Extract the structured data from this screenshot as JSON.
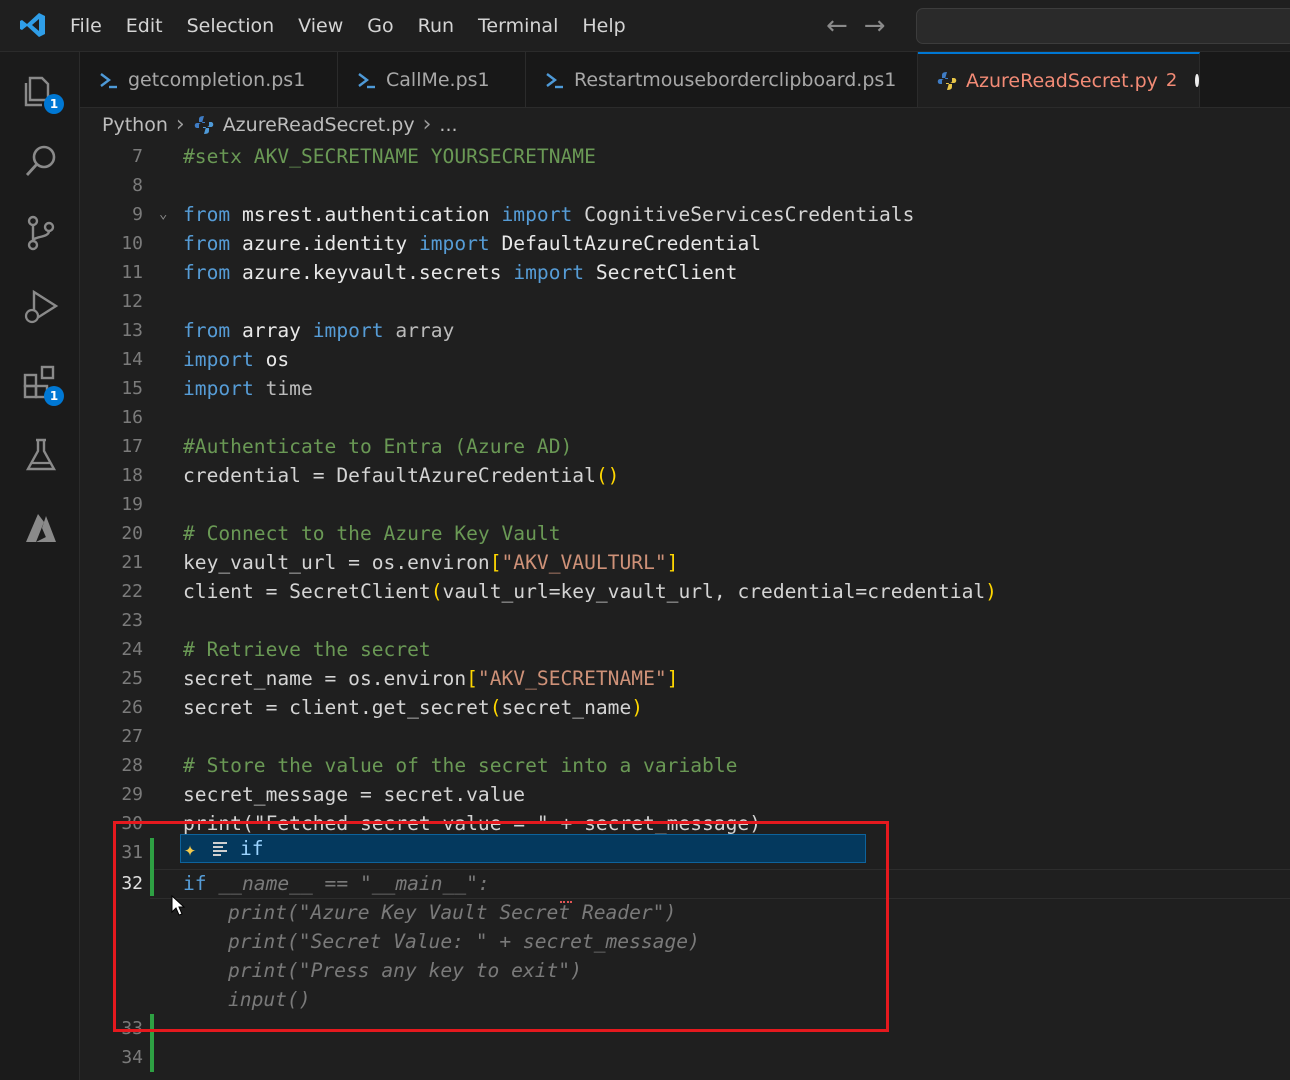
{
  "menu": {
    "items": [
      "File",
      "Edit",
      "Selection",
      "View",
      "Go",
      "Run",
      "Terminal",
      "Help"
    ]
  },
  "activity_bar": {
    "explorer_badge": "1",
    "extensions_badge": "1"
  },
  "tabs": [
    {
      "label": "getcompletion.ps1",
      "icon": "powershell-icon"
    },
    {
      "label": "CallMe.ps1",
      "icon": "powershell-icon"
    },
    {
      "label": "Restartmouseborderclipboard.ps1",
      "icon": "powershell-icon"
    },
    {
      "label": "AzureReadSecret.py",
      "icon": "python-icon",
      "badge": "2",
      "active": true,
      "unsaved": true
    }
  ],
  "breadcrumb": {
    "folder": "Python",
    "file": "AzureReadSecret.py",
    "tail": "..."
  },
  "editor": {
    "line_numbers": [
      "7",
      "8",
      "9",
      "10",
      "11",
      "12",
      "13",
      "14",
      "15",
      "16",
      "17",
      "18",
      "19",
      "20",
      "21",
      "22",
      "23",
      "24",
      "25",
      "26",
      "27",
      "28",
      "29",
      "30",
      "31",
      "32",
      "33",
      "34"
    ],
    "code": {
      "l7": "#setx AKV_SECRETNAME YOURSECRETNAME",
      "l9_from": "from",
      "l9_mod": " msrest.authentication ",
      "l9_import": "import",
      "l9_name": " CognitiveServicesCredentials",
      "l10_mod": " azure.identity ",
      "l10_name": " DefaultAzureCredential",
      "l11_mod": " azure.keyvault.secrets ",
      "l11_name": " SecretClient",
      "l13_mod": " array ",
      "l13_name": " array",
      "l14_name": " os",
      "l15_name": " time",
      "l17": "#Authenticate to Entra (Azure AD)",
      "l18_a": "credential = DefaultAzureCredential",
      "l18_b": "()",
      "l20": "# Connect to the Azure Key Vault",
      "l21_a": "key_vault_url = os.environ",
      "l21_str": "\"AKV_VAULTURL\"",
      "l22_a": "client = SecretClient",
      "l22_args": "vault_url=key_vault_url, credential=credential",
      "l24": "# Retrieve the secret",
      "l25_a": "secret_name = os.environ",
      "l25_str": "\"AKV_SECRETNAME\"",
      "l26_a": "secret = client.get_secret",
      "l26_args": "secret_name",
      "l28": "# Store the value of the secret into a variable",
      "l29": "secret_message = secret.value",
      "l30": "print(\"Fetched secret value = \" + secret_message)",
      "l32_kw": "if",
      "ghost_32": " __name__ == \"__main__\":",
      "ghost_33": "print(\"Azure Key Vault Secret Reader\")",
      "ghost_34": "print(\"Secret Value: \" + secret_message)",
      "ghost_35": "print(\"Press any key to exit\")",
      "ghost_36": "input()"
    },
    "keywords": {
      "from": "from",
      "import": "import"
    },
    "suggestion": {
      "label": "if"
    }
  },
  "colors": {
    "accent": "#0078d4",
    "annotation_box": "#e5191e",
    "active_tab_text": "#f38b76"
  }
}
